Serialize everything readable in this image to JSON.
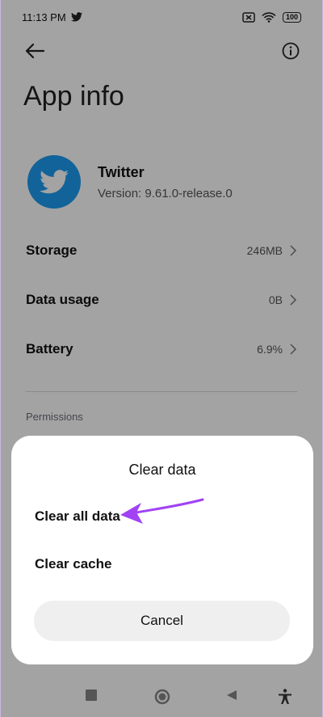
{
  "status_bar": {
    "time": "11:13 PM",
    "battery": "100"
  },
  "header": {
    "title": "App info",
    "back_icon": "arrow-left-icon",
    "info_icon": "info-circle-icon"
  },
  "app": {
    "name": "Twitter",
    "version": "Version: 9.61.0-release.0",
    "icon": "twitter-bird-icon",
    "brand_color": "#1d9bf0"
  },
  "rows": [
    {
      "label": "Storage",
      "value": "246MB"
    },
    {
      "label": "Data usage",
      "value": "0B"
    },
    {
      "label": "Battery",
      "value": "6.9%"
    }
  ],
  "section": {
    "permissions_label": "Permissions"
  },
  "dialog": {
    "title": "Clear data",
    "options": [
      "Clear all data",
      "Clear cache"
    ],
    "cancel_label": "Cancel",
    "annotation_arrow_color": "#a142f4"
  },
  "nav_bar": {
    "icons": [
      "recents-square-icon",
      "home-circle-icon",
      "back-triangle-icon",
      "accessibility-icon"
    ]
  }
}
